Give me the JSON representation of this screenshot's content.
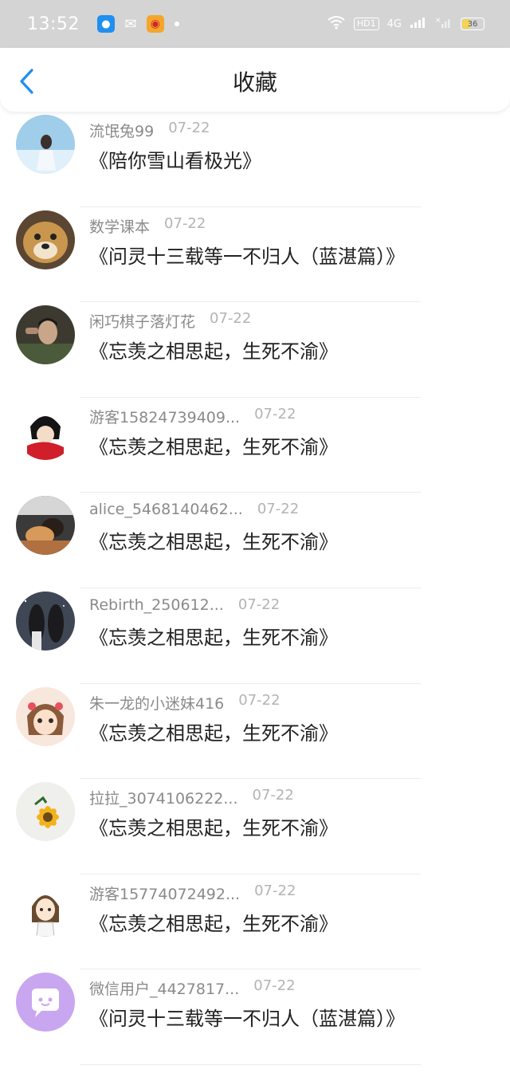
{
  "status_bar": {
    "time": "13:52",
    "apps": [
      "qq-icon",
      "wechat-icon",
      "weibo-icon"
    ],
    "hd": "HD1",
    "net": "4G",
    "battery": "36"
  },
  "header": {
    "title": "收藏",
    "back_icon": "chevron-left-icon",
    "accent": "#1e8ef0"
  },
  "favorites": [
    {
      "user": "流氓兔99",
      "date": "07-22",
      "title": "《陪你雪山看极光》"
    },
    {
      "user": "数学课本",
      "date": "07-22",
      "title": "《问灵十三载等一不归人（蓝湛篇）》"
    },
    {
      "user": "闲巧棋子落灯花",
      "date": "07-22",
      "title": "《忘羡之相思起，生死不渝》"
    },
    {
      "user": "游客15824739409...",
      "date": "07-22",
      "title": "《忘羡之相思起，生死不渝》"
    },
    {
      "user": "alice_5468140462...",
      "date": "07-22",
      "title": "《忘羡之相思起，生死不渝》"
    },
    {
      "user": "Rebirth_250612...",
      "date": "07-22",
      "title": "《忘羡之相思起，生死不渝》"
    },
    {
      "user": "朱一龙的小迷妹416",
      "date": "07-22",
      "title": "《忘羡之相思起，生死不渝》"
    },
    {
      "user": "拉拉_3074106222...",
      "date": "07-22",
      "title": "《忘羡之相思起，生死不渝》"
    },
    {
      "user": "游客15774072492...",
      "date": "07-22",
      "title": "《忘羡之相思起，生死不渝》"
    },
    {
      "user": "微信用户_4427817...",
      "date": "07-22",
      "title": "《问灵十三载等一不归人（蓝湛篇）》"
    }
  ]
}
